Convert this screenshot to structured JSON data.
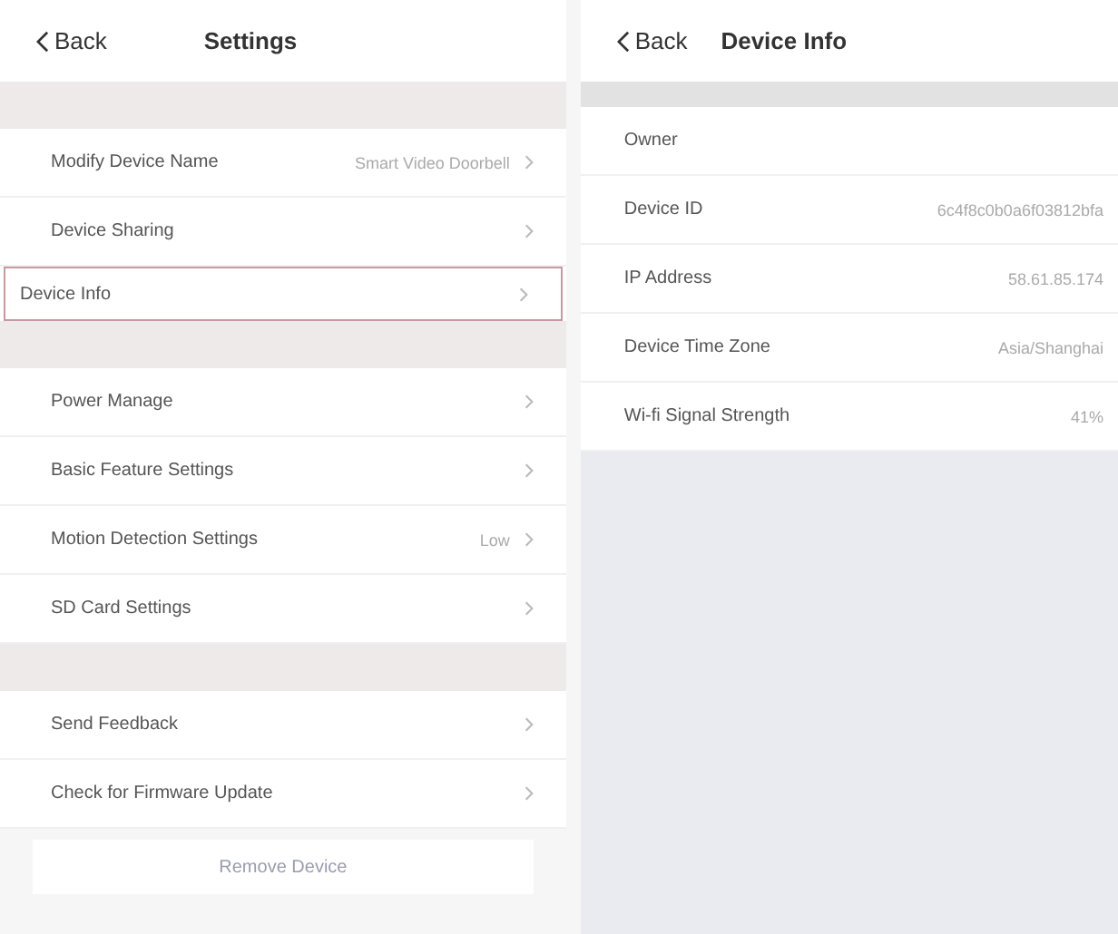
{
  "settings_screen": {
    "back": "Back",
    "title": "Settings",
    "groups": [
      {
        "items": [
          {
            "label": "Modify Device Name",
            "value": "Smart Video Doorbell",
            "selected": false
          },
          {
            "label": "Device Sharing",
            "selected": false
          },
          {
            "label": "Device Info",
            "selected": true
          }
        ]
      },
      {
        "items": [
          {
            "label": "Power Manage",
            "selected": false
          },
          {
            "label": "Basic Feature Settings",
            "selected": false
          },
          {
            "label": "Motion Detection Settings",
            "value": "Low",
            "selected": false
          },
          {
            "label": "SD Card Settings",
            "selected": false
          }
        ]
      },
      {
        "items": [
          {
            "label": "Send Feedback",
            "selected": false
          },
          {
            "label": "Check for Firmware Update",
            "selected": false
          }
        ]
      }
    ],
    "remove_button": "Remove Device"
  },
  "device_info_screen": {
    "back": "Back",
    "title": "Device Info",
    "rows": [
      {
        "label": "Owner"
      },
      {
        "label": "Device ID",
        "value": "6c4f8c0b0a6f03812bfa"
      },
      {
        "label": "IP Address",
        "value": "58.61.85.174"
      },
      {
        "label": "Device Time Zone",
        "value": "Asia/Shanghai"
      },
      {
        "label": "Wi-fi Signal Strength",
        "value": "41%"
      }
    ]
  }
}
